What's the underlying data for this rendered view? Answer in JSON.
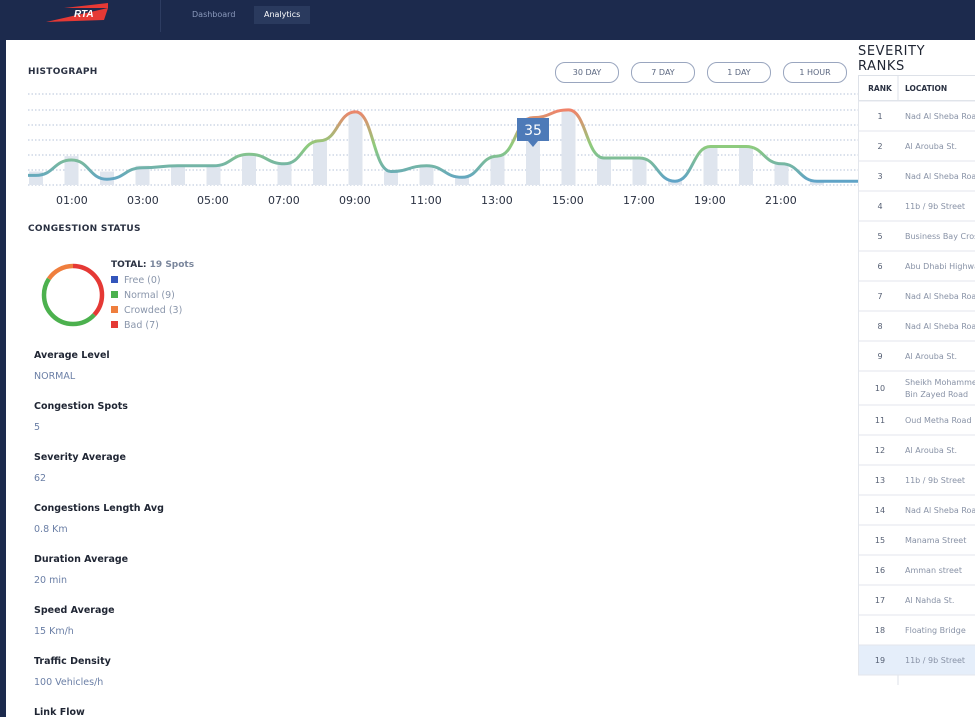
{
  "brand": {
    "logo_text": "RTA"
  },
  "nav": {
    "tabs": [
      {
        "label": "Dashboard"
      },
      {
        "label": "Analytics"
      }
    ]
  },
  "histograph": {
    "title": "HISTOGRAPH",
    "ranges": [
      "30 DAY",
      "7 DAY",
      "1 DAY",
      "1 HOUR"
    ],
    "tooltip": "35"
  },
  "chart_data": {
    "type": "line",
    "title": "HISTOGRAPH",
    "x_ticks": [
      "01:00",
      "03:00",
      "05:00",
      "07:00",
      "09:00",
      "11:00",
      "13:00",
      "15:00",
      "17:00",
      "19:00",
      "21:00"
    ],
    "series": [
      {
        "values": [
          5,
          13,
          3,
          9,
          10,
          10,
          16,
          11,
          23,
          38,
          7,
          10,
          4,
          15,
          35,
          39,
          14,
          14,
          2,
          20,
          20,
          11,
          2
        ]
      }
    ],
    "bars": [
      7,
      15,
      7,
      10,
      10,
      10,
      16,
      11,
      23,
      38,
      7,
      10,
      4,
      15,
      35,
      39,
      14,
      14,
      2,
      20,
      20,
      11,
      2
    ],
    "highlight_value": 35,
    "grid": true
  },
  "congestion": {
    "title": "CONGESTION STATUS",
    "total_label": "TOTAL:",
    "total_value": "19 Spots",
    "segments": [
      {
        "label": "Free (0)",
        "value": 0,
        "color": "#3355bb"
      },
      {
        "label": "Normal (9)",
        "value": 9,
        "color": "#4cb14e"
      },
      {
        "label": "Crowded (3)",
        "value": 3,
        "color": "#ef7e3d"
      },
      {
        "label": "Bad (7)",
        "value": 7,
        "color": "#e53935"
      }
    ]
  },
  "metrics": [
    {
      "label": "Average Level",
      "value": "NORMAL"
    },
    {
      "label": "Congestion Spots",
      "value": "5"
    },
    {
      "label": "Severity Average",
      "value": "62"
    },
    {
      "label": "Congestions Length Avg",
      "value": "0.8 Km"
    },
    {
      "label": "Duration Average",
      "value": "20 min"
    },
    {
      "label": "Speed Average",
      "value": "15 Km/h"
    },
    {
      "label": "Traffic Density",
      "value": "100 Vehicles/h"
    },
    {
      "label": "Link Flow",
      "value": ""
    }
  ],
  "severity": {
    "title": "SEVERITY RANKS",
    "columns": {
      "rank": "RANK",
      "location": "LOCATION"
    },
    "rows": [
      {
        "rank": "1",
        "location": "Nad Al Sheba Road"
      },
      {
        "rank": "2",
        "location": "Al Arouba St."
      },
      {
        "rank": "3",
        "location": "Nad Al Sheba Road"
      },
      {
        "rank": "4",
        "location": "11b / 9b Street"
      },
      {
        "rank": "5",
        "location": "Business Bay Crossing"
      },
      {
        "rank": "6",
        "location": "Abu Dhabi Highway"
      },
      {
        "rank": "7",
        "location": "Nad Al Sheba Road"
      },
      {
        "rank": "8",
        "location": "Nad Al Sheba Road"
      },
      {
        "rank": "9",
        "location": "Al Arouba St."
      },
      {
        "rank": "10",
        "location": "Sheikh Mohammed Bin Zayed Road"
      },
      {
        "rank": "11",
        "location": "Oud Metha Road"
      },
      {
        "rank": "12",
        "location": "Al Arouba St."
      },
      {
        "rank": "13",
        "location": "11b / 9b Street"
      },
      {
        "rank": "14",
        "location": "Nad Al Sheba Road"
      },
      {
        "rank": "15",
        "location": "Manama Street"
      },
      {
        "rank": "16",
        "location": "Amman street"
      },
      {
        "rank": "17",
        "location": "Al Nahda St."
      },
      {
        "rank": "18",
        "location": "Floating Bridge"
      },
      {
        "rank": "19",
        "location": "11b / 9b Street"
      }
    ]
  }
}
